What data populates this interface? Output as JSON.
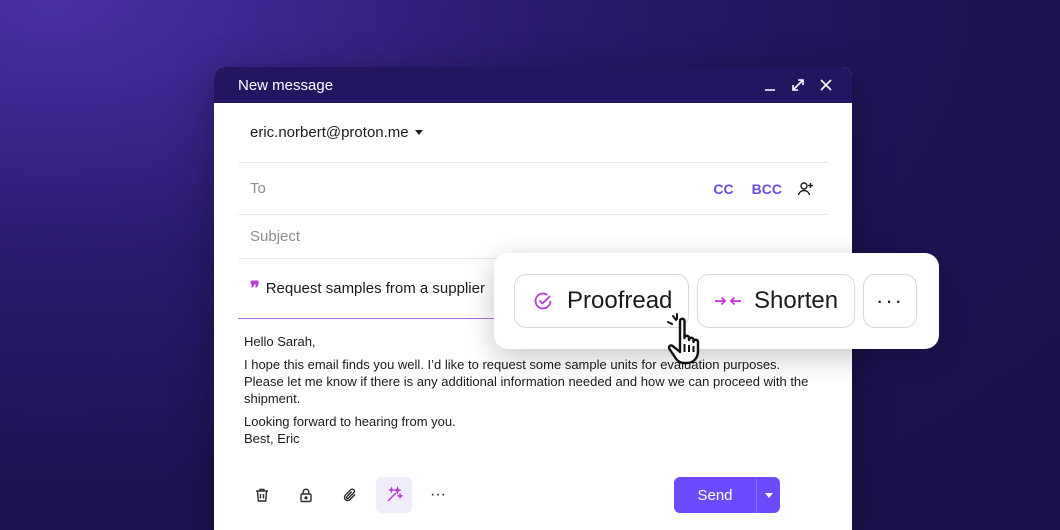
{
  "window": {
    "title": "New message"
  },
  "from": {
    "address": "eric.norbert@proton.me"
  },
  "to": {
    "placeholder": "To",
    "cc_label": "CC",
    "bcc_label": "BCC"
  },
  "subject": {
    "placeholder": "Subject"
  },
  "prompt": {
    "text": "Request samples from a supplier"
  },
  "email_body": {
    "greeting": "Hello Sarah,",
    "paragraph": "I hope this email finds you well. I’d like to request some sample units for evaluation purposes. Please let me know if there is any additional information needed and how we can proceed with the shipment.",
    "closing": "Looking forward to hearing from you.",
    "signature": "Best, Eric"
  },
  "toolbar": {
    "icons": [
      "trash-icon",
      "lock-icon",
      "paperclip-icon",
      "magic-wand-icon",
      "more-icon"
    ],
    "more_label": "···",
    "send_label": "Send"
  },
  "ai_popup": {
    "proofread_label": "Proofread",
    "shorten_label": "Shorten",
    "more_label": "···"
  },
  "colors": {
    "accent": "#6d4aff",
    "titlebar": "#241560",
    "prompt_accent": "#b33fd6",
    "shorten_accent": "#c23bd8"
  }
}
